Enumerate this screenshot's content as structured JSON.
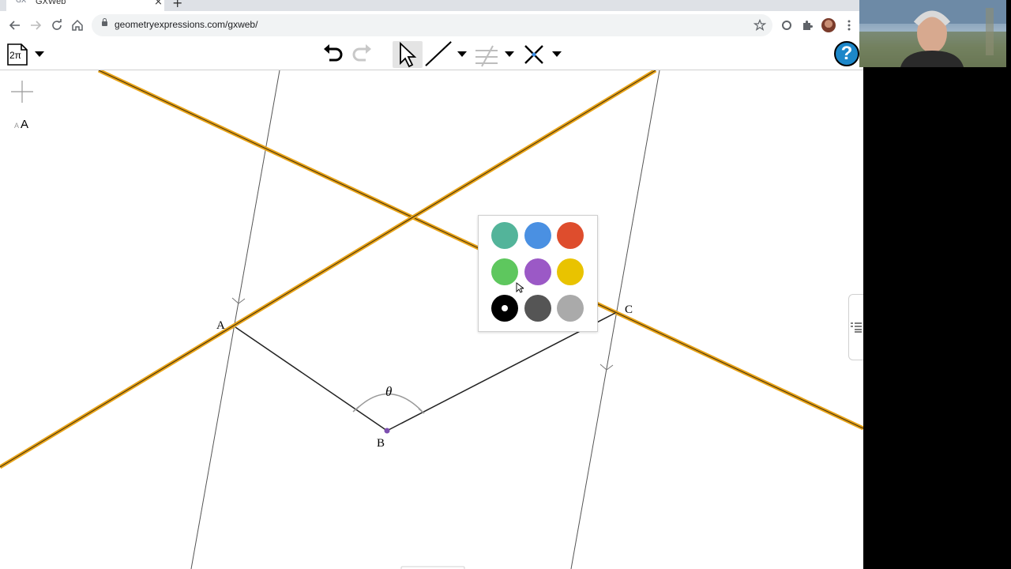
{
  "browser": {
    "tab_title": "GXWeb",
    "tab_favicon": "GX",
    "tab_close": "×",
    "new_tab": "+",
    "url": "geometryexpressions.com/gxweb/",
    "icons": [
      "back-arrow-icon",
      "forward-arrow-icon",
      "reload-icon",
      "home-icon",
      "lock-icon",
      "star-icon",
      "extension-circle-icon",
      "puzzle-icon",
      "profile-avatar",
      "kebab-menu-icon"
    ]
  },
  "toolbar": {
    "file_label": "2π",
    "tools": [
      "undo-icon",
      "redo-icon",
      "select-arrow-icon",
      "line-tool-icon",
      "constrain-tool-icon",
      "intersection-tool-icon"
    ],
    "help_label": "?"
  },
  "canvas": {
    "side_tools": {
      "point_tool": "+",
      "text_tool_small": "A",
      "text_tool_large": "A"
    },
    "points": [
      {
        "label": "A"
      },
      {
        "label": "B"
      },
      {
        "label": "C"
      }
    ],
    "angle_label": "θ"
  },
  "palette": {
    "colors": [
      "#53b49a",
      "#4a90e2",
      "#de4d2d",
      "#5ec75e",
      "#9b59c6",
      "#e9c300",
      "#000000",
      "#555555",
      "#aaaaaa"
    ],
    "selected_index": 6
  },
  "colors": {
    "highlight": "#e8a317",
    "line": "#333333",
    "point": "#7d4fb0"
  }
}
